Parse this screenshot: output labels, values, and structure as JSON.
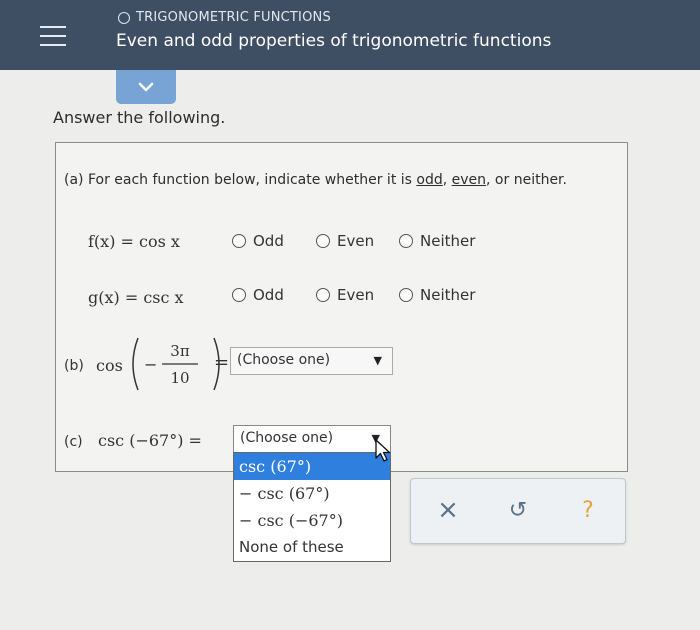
{
  "header": {
    "topic": "TRIGONOMETRIC FUNCTIONS",
    "subtitle": "Even and odd properties of trigonometric functions"
  },
  "instruction": "Answer the following.",
  "part_a": {
    "prompt_before": "(a) For each function below, indicate whether it is ",
    "odd": "odd",
    "sep1": ", ",
    "even": "even",
    "sep2": ", or neither.",
    "rows": [
      {
        "function": "f(x) = cos x",
        "options": [
          "Odd",
          "Even",
          "Neither"
        ]
      },
      {
        "function": "g(x) = csc x",
        "options": [
          "Odd",
          "Even",
          "Neither"
        ]
      }
    ]
  },
  "part_b": {
    "label": "(b)",
    "func": "cos",
    "numerator": "3π",
    "denominator": "10",
    "minus": "−",
    "equals": "=",
    "select_value": "(Choose one)"
  },
  "part_c": {
    "label": "(c)",
    "expression": "csc (−67°) =",
    "select_value": "(Choose one)",
    "options": [
      "csc (67°)",
      "− csc (67°)",
      "− csc (−67°)",
      "None of these"
    ],
    "highlighted_index": 0
  },
  "actions": {
    "clear": "×",
    "undo": "↺",
    "help": "?"
  },
  "colors": {
    "topbar": "#3e4e63",
    "expand_tab": "#77a4d4",
    "dropdown_highlight": "#2f7fde",
    "action_icon": "#5a6f88",
    "help_icon": "#e6a13a"
  }
}
